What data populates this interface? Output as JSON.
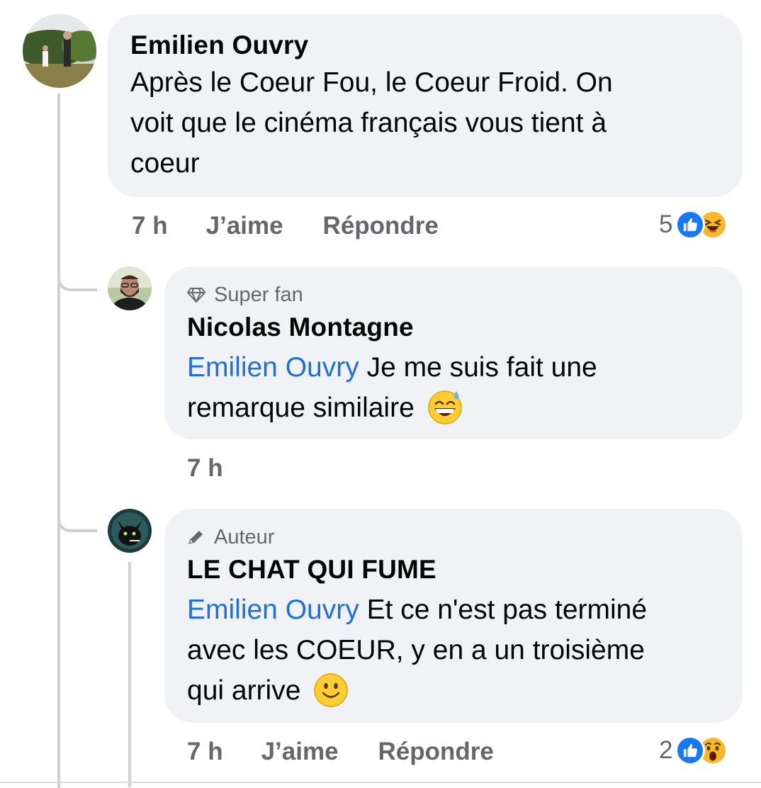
{
  "comments": [
    {
      "author": "Emilien Ouvry",
      "text": "Après le Coeur Fou, le Coeur Froid. On voit que le cinéma français vous tient à coeur",
      "line1": "Après le Coeur Fou, le Coeur Froid. On",
      "line2": "voit que le cinéma français vous tient à",
      "line3": "coeur",
      "time": "7 h",
      "like_label": "J’aime",
      "reply_label": "Répondre",
      "reaction_count": "5",
      "reactions": [
        "like-icon",
        "laughing-icon"
      ]
    }
  ],
  "replies": [
    {
      "badge": "Super fan",
      "badge_icon": "diamond-icon",
      "author": "Nicolas Montagne",
      "mention": "Emilien Ouvry",
      "line1": " Je me suis fait une",
      "line2": "remarque similaire",
      "emoji": "grinning-sweat-emoji",
      "time": "7 h"
    },
    {
      "badge": "Auteur",
      "badge_icon": "pencil-icon",
      "author": "LE CHAT QUI FUME",
      "mention": "Emilien Ouvry",
      "line1": " Et ce n'est pas terminé",
      "line2": "avec les COEUR, y en a un troisième",
      "line3": "qui arrive",
      "emoji": "smiling-face-emoji",
      "time": "7 h",
      "like_label": "J’aime",
      "reply_label": "Répondre",
      "reaction_count": "2",
      "reactions": [
        "like-icon",
        "wow-icon"
      ]
    }
  ],
  "colors": {
    "bubble": "#f0f2f5",
    "mention": "#216fdb",
    "meta": "#65676b",
    "like_blue": "#1877f2",
    "thread_line": "#ced0d4"
  }
}
